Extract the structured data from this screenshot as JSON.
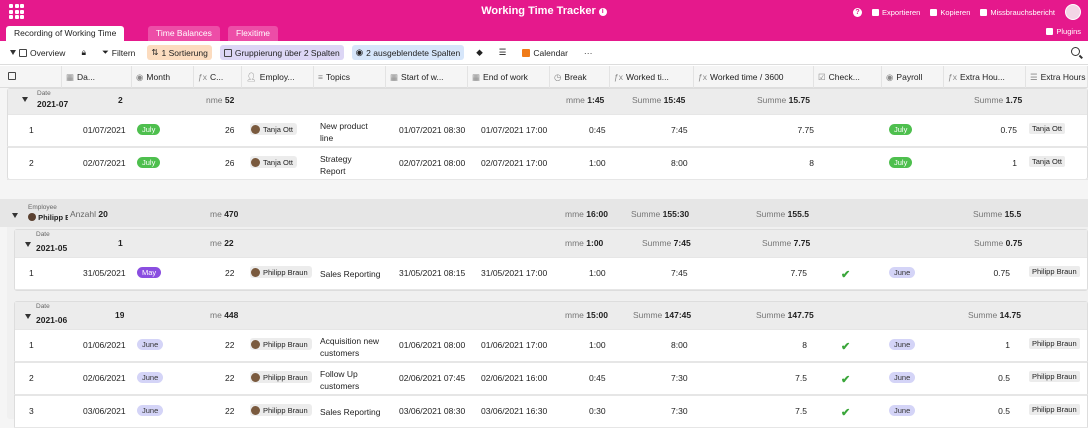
{
  "app": {
    "title": "Working Time Tracker",
    "export": "Exportieren",
    "copy": "Kopieren",
    "report": "Missbrauchsbericht",
    "plugins": "Plugins"
  },
  "tabs": [
    "Recording of Working Time",
    "Time Balances",
    "Flexitime"
  ],
  "toolbar": {
    "view": "Overview",
    "filter": "Filtern",
    "sort": "1 Sortierung",
    "group": "Gruppierung über 2 Spalten",
    "hidden": "2 ausgeblendete Spalten",
    "calendar": "Calendar",
    "more": "···"
  },
  "columns": [
    "Da...",
    "Month",
    "C...",
    "Employ...",
    "Topics",
    "Start of w...",
    "End of work",
    "Break",
    "Worked ti...",
    "Worked time / 3600",
    "Check...",
    "Payroll",
    "Extra Hou...",
    "Extra Hours"
  ],
  "labels": {
    "date": "Date",
    "employee": "Employee",
    "anzahl": "Anzahl",
    "summe": "Summe",
    "me": "me",
    "mme": "mme",
    "nme": "nme"
  },
  "groups": {
    "g1": {
      "date": "2021-07",
      "count": "2",
      "c": "52",
      "brk": "1:45",
      "wt": "15:45",
      "wt3600": "15.75",
      "extra": "1.75"
    },
    "emp": {
      "name": "Philipp Braun",
      "count": "20",
      "c": "470",
      "brk": "16:00",
      "wt": "155:30",
      "wt3600": "155.5",
      "extra": "15.5"
    },
    "g2": {
      "date": "2021-05",
      "count": "1",
      "c": "22",
      "brk": "1:00",
      "wt": "7:45",
      "wt3600": "7.75",
      "extra": "0.75"
    },
    "g3": {
      "date": "2021-06",
      "count": "19",
      "c": "448",
      "brk": "15:00",
      "wt": "147:45",
      "wt3600": "147.75",
      "extra": "14.75"
    }
  },
  "rows": [
    {
      "n": "1",
      "date": "01/07/2021",
      "month": "July",
      "c": "26",
      "emp": "Tanja Ott",
      "topic1": "New product",
      "topic2": "line",
      "start": "01/07/2021 08:30",
      "end": "01/07/2021 17:00",
      "brk": "0:45",
      "wt": "7:45",
      "wt3600": "7.75",
      "pay": "July",
      "extra": "0.75",
      "eh": "Tanja Ott"
    },
    {
      "n": "2",
      "date": "02/07/2021",
      "month": "July",
      "c": "26",
      "emp": "Tanja Ott",
      "topic1": "Strategy",
      "topic2": "Report",
      "start": "02/07/2021 08:00",
      "end": "02/07/2021 17:00",
      "brk": "1:00",
      "wt": "8:00",
      "wt3600": "8",
      "pay": "July",
      "extra": "1",
      "eh": "Tanja Ott"
    },
    {
      "n": "1",
      "date": "31/05/2021",
      "month": "May",
      "c": "22",
      "emp": "Philipp Braun",
      "topic1": "Sales Reporting",
      "topic2": "",
      "start": "31/05/2021 08:15",
      "end": "31/05/2021 17:00",
      "brk": "1:00",
      "wt": "7:45",
      "wt3600": "7.75",
      "pay": "June",
      "extra": "0.75",
      "eh": "Philipp Braun"
    },
    {
      "n": "1",
      "date": "01/06/2021",
      "month": "June",
      "c": "22",
      "emp": "Philipp Braun",
      "topic1": "Acquisition new",
      "topic2": "customers",
      "start": "01/06/2021 08:00",
      "end": "01/06/2021 17:00",
      "brk": "1:00",
      "wt": "8:00",
      "wt3600": "8",
      "pay": "June",
      "extra": "1",
      "eh": "Philipp Braun"
    },
    {
      "n": "2",
      "date": "02/06/2021",
      "month": "June",
      "c": "22",
      "emp": "Philipp Braun",
      "topic1": "Follow Up",
      "topic2": "customers",
      "start": "02/06/2021 07:45",
      "end": "02/06/2021 16:00",
      "brk": "0:45",
      "wt": "7:30",
      "wt3600": "7.5",
      "pay": "June",
      "extra": "0.5",
      "eh": "Philipp Braun"
    },
    {
      "n": "3",
      "date": "03/06/2021",
      "month": "June",
      "c": "22",
      "emp": "Philipp Braun",
      "topic1": "Sales Reporting",
      "topic2": "",
      "start": "03/06/2021 08:30",
      "end": "03/06/2021 16:30",
      "brk": "0:30",
      "wt": "7:30",
      "wt3600": "7.5",
      "pay": "June",
      "extra": "0.5",
      "eh": "Philipp Braun"
    }
  ]
}
